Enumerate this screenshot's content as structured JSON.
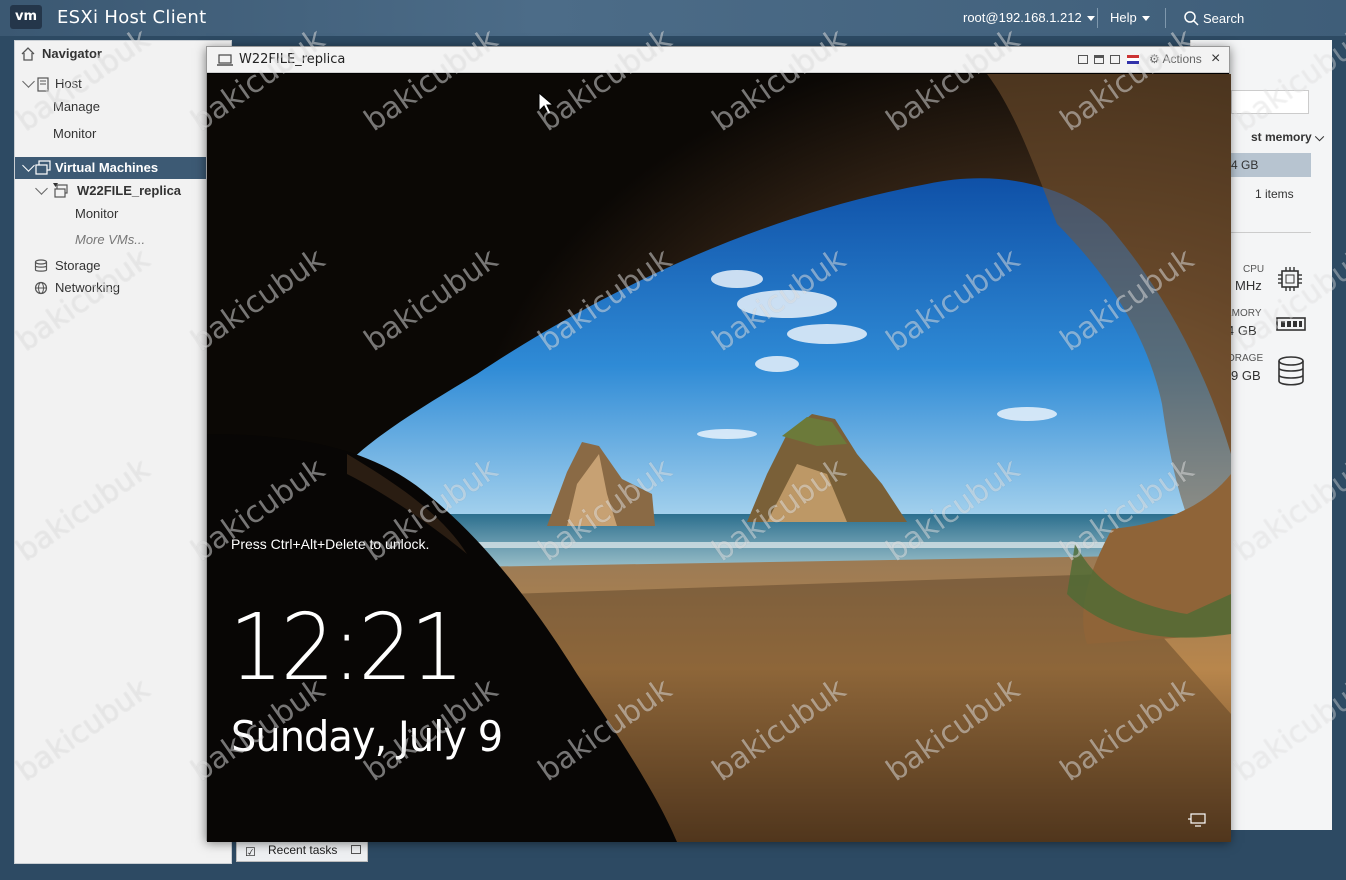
{
  "header": {
    "logo": "vm",
    "app_title": "ESXi Host Client",
    "user": "root@192.168.1.212",
    "help": "Help",
    "search": "Search"
  },
  "navigator": {
    "title": "Navigator",
    "host": "Host",
    "host_manage": "Manage",
    "host_monitor": "Monitor",
    "virtual_machines": "Virtual Machines",
    "vm_name": "W22FILE_replica",
    "vm_monitor": "Monitor",
    "more_vms": "More VMs...",
    "storage": "Storage",
    "networking": "Networking"
  },
  "background_panel": {
    "memory_dropdown": "st memory",
    "memory_value": "4 GB",
    "items_count": "1 items",
    "cpu_label": "CPU",
    "cpu_value": "MHz",
    "memory_label": "EMORY",
    "memory_used": "4 GB",
    "storage_label": "ORAGE",
    "storage_value": "9 GB"
  },
  "console": {
    "title": "W22FILE_replica",
    "actions": "Actions",
    "lock_hint": "Press Ctrl+Alt+Delete to unlock.",
    "time": "12:21",
    "date": "Sunday, July 9"
  },
  "footer": {
    "recent_tasks": "Recent tasks"
  },
  "watermark": "bakicubuk",
  "colors": {
    "header_bg": "#3b5872",
    "selected_nav": "#3d5a74",
    "sky": "#2a7fd0",
    "sand": "#b8864c"
  }
}
